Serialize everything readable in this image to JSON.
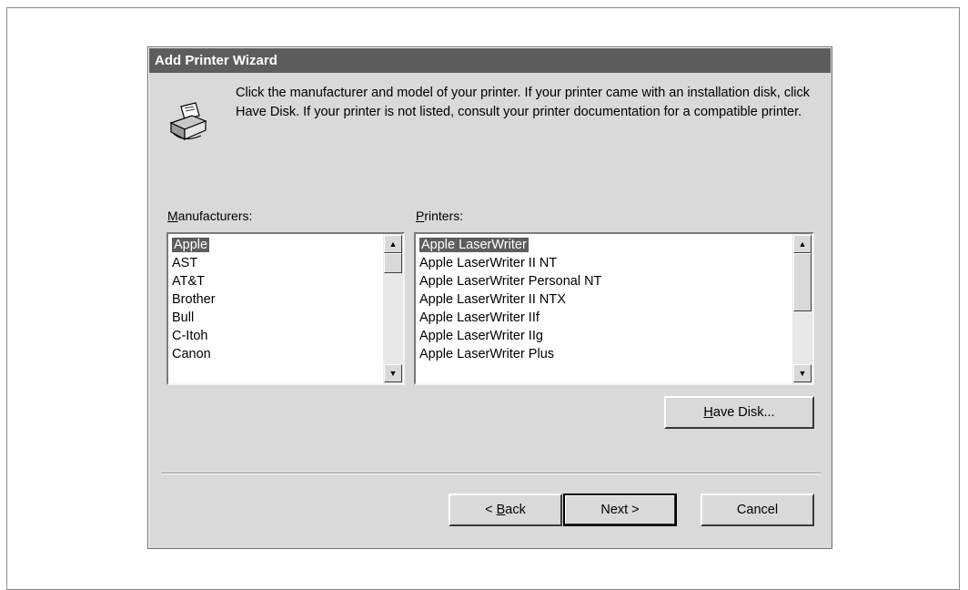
{
  "dialog": {
    "title": "Add Printer Wizard",
    "instructions": "Click the manufacturer and model of your printer. If your printer came with an installation disk, click Have Disk. If your printer is not listed, consult your printer documentation for a compatible printer.",
    "icon": "printer-icon"
  },
  "manufacturers": {
    "label_key": "M",
    "label_rest": "anufacturers:",
    "items": [
      "Apple",
      "AST",
      "AT&T",
      "Brother",
      "Bull",
      "C-Itoh",
      "Canon"
    ],
    "selected": "Apple"
  },
  "printers": {
    "label_key": "P",
    "label_rest": "rinters:",
    "items": [
      "Apple LaserWriter",
      "Apple LaserWriter II NT",
      "Apple LaserWriter Personal NT",
      "Apple LaserWriter II NTX",
      "Apple LaserWriter IIf",
      "Apple LaserWriter IIg",
      "Apple LaserWriter Plus"
    ],
    "selected": "Apple LaserWriter"
  },
  "buttons": {
    "have_disk_key": "H",
    "have_disk_rest": "ave Disk...",
    "back_prefix": "< ",
    "back_key": "B",
    "back_rest": "ack",
    "next": "Next >",
    "cancel": "Cancel"
  },
  "colors": {
    "titlebar": "#5d5d5d",
    "dialog_bg": "#d9d9d9",
    "selection": "#5d5d5d"
  }
}
